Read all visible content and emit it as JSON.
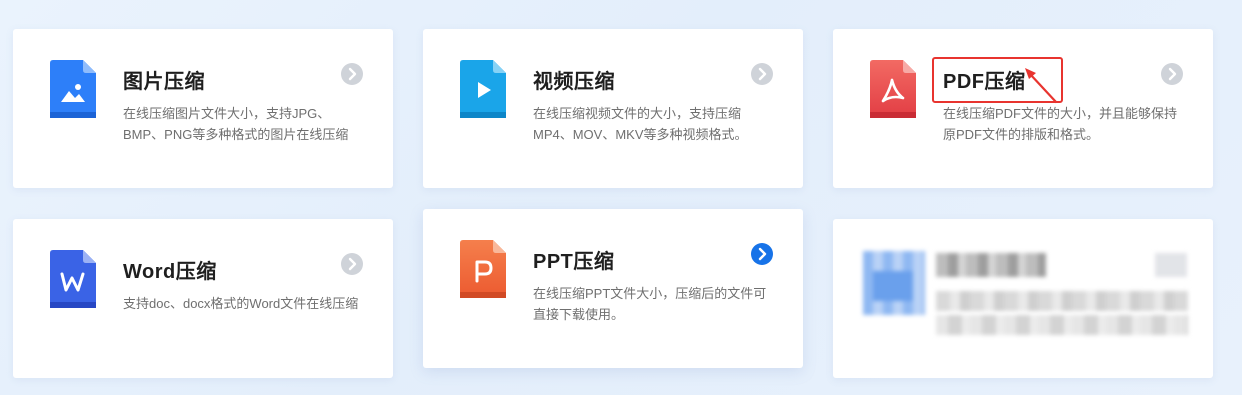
{
  "cards": [
    {
      "title": "图片压缩",
      "desc": "在线压缩图片文件大小，支持JPG、BMP、PNG等多种格式的图片在线压缩",
      "icon": "image-file-icon",
      "color": "#2d7ff9"
    },
    {
      "title": "视频压缩",
      "desc": "在线压缩视频文件的大小，支持压缩MP4、MOV、MKV等多种视频格式。",
      "icon": "video-file-icon",
      "color": "#1aa5e9"
    },
    {
      "title": "PDF压缩",
      "desc": "在线压缩PDF文件的大小，并且能够保持原PDF文件的排版和格式。",
      "icon": "pdf-file-icon",
      "color": "#e8474b"
    },
    {
      "title": "Word压缩",
      "desc": "支持doc、docx格式的Word文件在线压缩",
      "icon": "word-file-icon",
      "color": "#3a63e6"
    },
    {
      "title": "PPT压缩",
      "desc": "在线压缩PPT文件大小，压缩后的文件可直接下载使用。",
      "icon": "ppt-file-icon",
      "color": "#f06a3c",
      "active": true
    }
  ],
  "colors": {
    "accent": "#1773e8",
    "highlight": "#e8342f"
  }
}
